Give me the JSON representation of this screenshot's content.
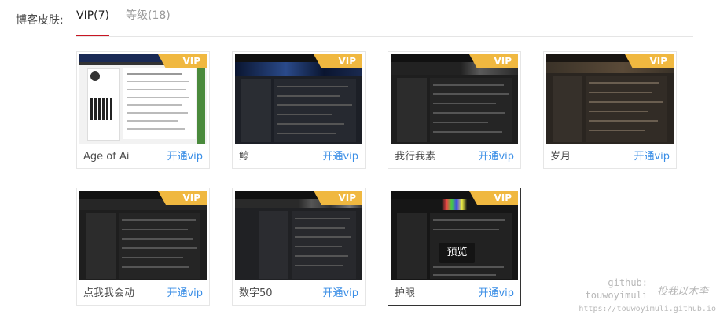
{
  "header": {
    "label": "博客皮肤:",
    "tabs": [
      {
        "label": "VIP(7)",
        "active": true
      },
      {
        "label": "等级(18)",
        "active": false
      }
    ]
  },
  "skins": [
    {
      "name": "Age of Ai",
      "badge": "VIP",
      "action": "开通vip",
      "theme": "light"
    },
    {
      "name": "鲸",
      "badge": "VIP",
      "action": "开通vip",
      "theme": "dark-blue"
    },
    {
      "name": "我行我素",
      "badge": "VIP",
      "action": "开通vip",
      "theme": "dark"
    },
    {
      "name": "岁月",
      "badge": "VIP",
      "action": "开通vip",
      "theme": "dark-brown"
    },
    {
      "name": "点我我会动",
      "badge": "VIP",
      "action": "开通vip",
      "theme": "dark"
    },
    {
      "name": "数字50",
      "badge": "VIP",
      "action": "开通vip",
      "theme": "dark-grey"
    },
    {
      "name": "护眼",
      "badge": "VIP",
      "action": "开通vip",
      "theme": "dark",
      "selected": true,
      "preview_label": "预览"
    }
  ],
  "watermark": {
    "github_label": "github:",
    "username": "touwoyimuli",
    "motto": "投我以木李",
    "url": "https://touwoyimuli.github.io"
  },
  "colors": {
    "accent_underline": "#c81623",
    "vip_badge": "#f0b840",
    "link_blue": "#3a8ee6"
  }
}
